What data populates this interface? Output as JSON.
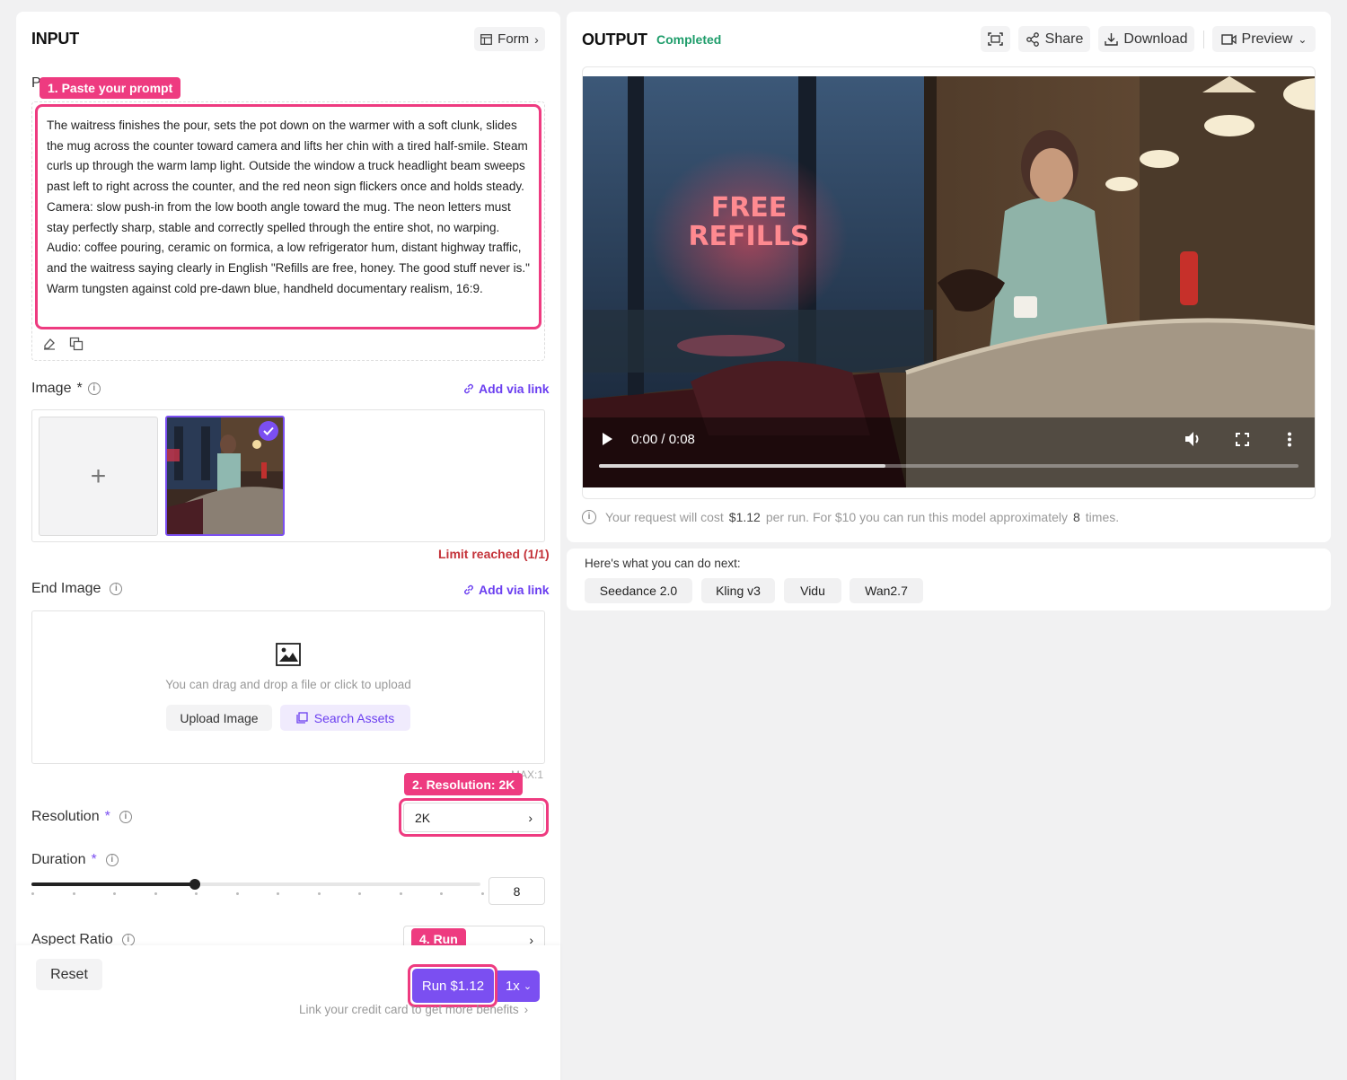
{
  "input": {
    "title": "INPUT",
    "form_label": "Form",
    "prompt_label_initial": "P",
    "tag_prompt": "1. Paste your prompt",
    "prompt_text": "The waitress finishes the pour, sets the pot down on the warmer with a soft clunk, slides the mug across the counter toward camera and lifts her chin with a tired half-smile. Steam curls up through the warm lamp light. Outside the window a truck headlight beam sweeps past left to right across the counter, and the red neon sign flickers once and holds steady. Camera: slow push-in from the low booth angle toward the mug. The neon letters must stay perfectly sharp, stable and correctly spelled through the entire shot, no warping. Audio: coffee pouring, ceramic on formica, a low refrigerator hum, distant highway traffic, and the waitress saying clearly in English \"Refills are free, honey. The good stuff never is.\" Warm tungsten against cold pre-dawn blue, handheld documentary realism, 16:9.",
    "image_label": "Image",
    "required_mark": "*",
    "add_via_link": "Add via link",
    "add_plus": "+",
    "limit_text": "Limit reached (1/1)",
    "end_image_label": "End Image",
    "drop_hint": "You can drag and drop a file or click to upload",
    "upload_button": "Upload Image",
    "search_assets": "Search Assets",
    "max_text": "MAX:1",
    "tag_resolution": "2. Resolution: 2K",
    "resolution_label": "Resolution",
    "resolution_value": "2K",
    "duration_label": "Duration",
    "duration_value": "8",
    "duration_fraction": 0.364,
    "aspect_label": "Aspect Ratio",
    "tag_run": "4. Run",
    "reset_label": "Reset",
    "run_label": "Run $1.12",
    "multiplier": "1x",
    "credit_link": "Link your credit card to get more benefits"
  },
  "output": {
    "title": "OUTPUT",
    "status": "Completed",
    "share": "Share",
    "download": "Download",
    "preview": "Preview",
    "neon_line1": "FREE",
    "neon_line2": "REFILLS",
    "time": "0:00 / 0:08",
    "progress_fraction": 0.41,
    "cost_prefix": "Your request will cost",
    "cost_value": "$1.12",
    "cost_mid": "per run. For $10 you can run this model approximately",
    "cost_times": "8",
    "cost_suffix": "times."
  },
  "next": {
    "heading": "Here's what you can do next:",
    "chips": [
      "Seedance 2.0",
      "Kling v3",
      "Vidu",
      "Wan2.7"
    ]
  },
  "colors": {
    "accent": "#7b4ff1",
    "highlight": "#ee3b80",
    "success": "#1f9d6b",
    "warning": "#c4333a"
  }
}
